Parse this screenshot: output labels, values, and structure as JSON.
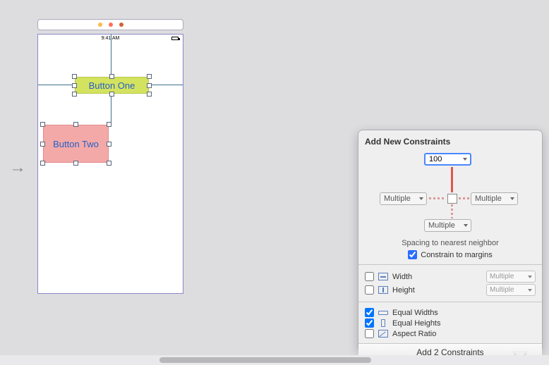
{
  "canvas": {
    "status_time": "9:41 AM",
    "button_one_label": "Button One",
    "button_two_label": "Button Two"
  },
  "popover": {
    "title": "Add New Constraints",
    "top_value": "100",
    "left_value": "Multiple",
    "right_value": "Multiple",
    "bottom_value": "Multiple",
    "spacing_text": "Spacing to nearest neighbor",
    "constrain_margins_label": "Constrain to margins",
    "constrain_margins_checked": true,
    "width_label": "Width",
    "width_checked": false,
    "width_value": "Multiple",
    "height_label": "Height",
    "height_checked": false,
    "height_value": "Multiple",
    "equal_widths_label": "Equal Widths",
    "equal_widths_checked": true,
    "equal_heights_label": "Equal Heights",
    "equal_heights_checked": true,
    "aspect_ratio_label": "Aspect Ratio",
    "aspect_ratio_checked": false,
    "action_label": "Add 2 Constraints"
  }
}
